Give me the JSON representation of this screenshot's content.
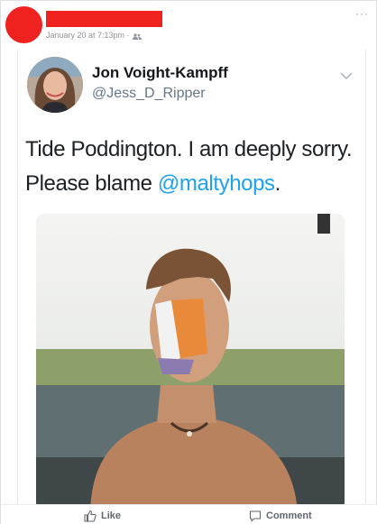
{
  "post": {
    "timestamp": "January 20 at 7:13pm · ",
    "audience_icon": "friends-icon",
    "more_icon": "more-options-icon",
    "colors": {
      "redaction": "#f0221f",
      "meta": "#90949c",
      "link": "#1da1f2"
    }
  },
  "tweet": {
    "display_name": "Jon Voight-Kampff",
    "handle": "@Jess_D_Ripper",
    "text_before": "Tide Poddington. I am deeply sorry. Please blame ",
    "mention": "@maltyhops",
    "text_after": ".",
    "chevron_icon": "chevron-down-icon"
  },
  "actions": {
    "like_label": "Like",
    "comment_label": "Comment"
  }
}
